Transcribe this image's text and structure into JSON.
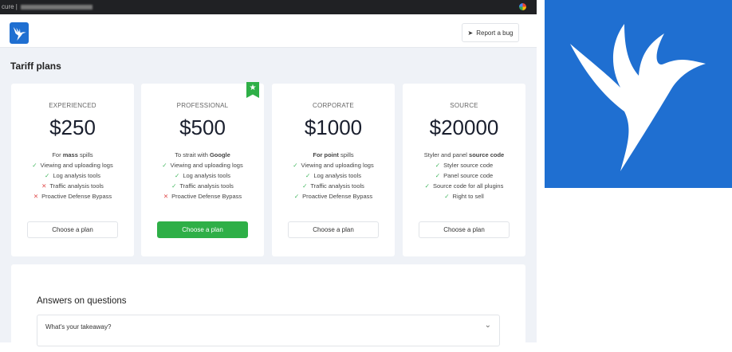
{
  "browser": {
    "url_prefix": "cure |"
  },
  "header": {
    "report_bug": "Report a bug"
  },
  "page_title": "Tariff plans",
  "plans": [
    {
      "tier": "EXPERIENCED",
      "price": "$250",
      "desc_pre": "For ",
      "desc_bold": "mass",
      "desc_post": " spills",
      "featured": false,
      "features": [
        {
          "text": "Viewing and uploading logs",
          "ok": true
        },
        {
          "text": "Log analysis tools",
          "ok": true
        },
        {
          "text": "Traffic analysis tools",
          "ok": false
        },
        {
          "text": "Proactive Defense Bypass",
          "ok": false
        }
      ],
      "button": "Choose a plan"
    },
    {
      "tier": "PROFESSIONAL",
      "price": "$500",
      "desc_pre": "To strait with ",
      "desc_bold": "Google",
      "desc_post": "",
      "featured": true,
      "features": [
        {
          "text": "Viewing and uploading logs",
          "ok": true
        },
        {
          "text": "Log analysis tools",
          "ok": true
        },
        {
          "text": "Traffic analysis tools",
          "ok": true
        },
        {
          "text": "Proactive Defense Bypass",
          "ok": false
        }
      ],
      "button": "Choose a plan"
    },
    {
      "tier": "CORPORATE",
      "price": "$1000",
      "desc_pre": "",
      "desc_bold": "For point",
      "desc_post": " spills",
      "featured": false,
      "features": [
        {
          "text": "Viewing and uploading logs",
          "ok": true
        },
        {
          "text": "Log analysis tools",
          "ok": true
        },
        {
          "text": "Traffic analysis tools",
          "ok": true
        },
        {
          "text": "Proactive Defense Bypass",
          "ok": true
        }
      ],
      "button": "Choose a plan"
    },
    {
      "tier": "SOURCE",
      "price": "$20000",
      "desc_pre": "Styler and panel ",
      "desc_bold": "source code",
      "desc_post": "",
      "featured": false,
      "features": [
        {
          "text": "Styler source code",
          "ok": true
        },
        {
          "text": "Panel source code",
          "ok": true
        },
        {
          "text": "Source code for all plugins",
          "ok": true
        },
        {
          "text": "Right to sell",
          "ok": true
        }
      ],
      "button": "Choose a plan"
    }
  ],
  "faq": {
    "title": "Answers on questions",
    "items": [
      {
        "question": "What's your takeaway?"
      }
    ]
  },
  "colors": {
    "brand": "#1f6fd1",
    "accent": "#2eaf47",
    "bg": "#eff2f7"
  }
}
